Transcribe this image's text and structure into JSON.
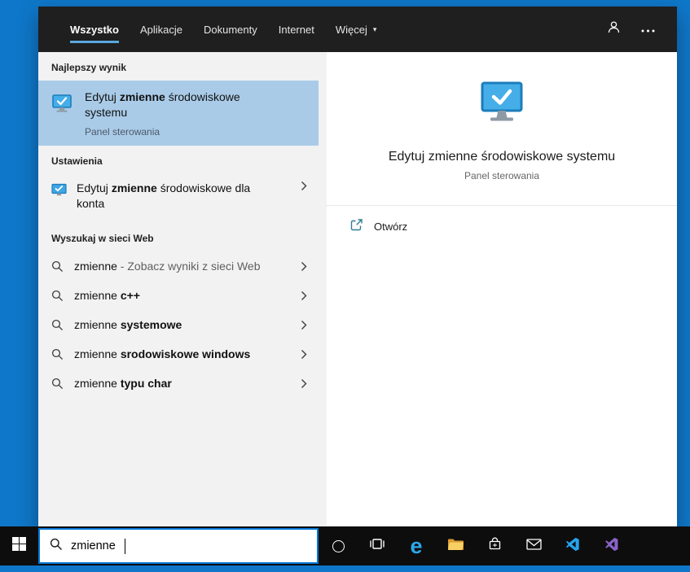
{
  "icons": {
    "dropdown": "▾",
    "edge": "e"
  },
  "colors": {
    "accent": "#0078d7",
    "desktop_background": "#0f77c9",
    "selection_highlight": "#a9cbe8",
    "topbar_background": "#1f1f1f"
  },
  "topbar": {
    "tabs": [
      {
        "label": "Wszystko",
        "active": true
      },
      {
        "label": "Aplikacje",
        "active": false
      },
      {
        "label": "Dokumenty",
        "active": false
      },
      {
        "label": "Internet",
        "active": false
      },
      {
        "label": "Więcej",
        "active": false,
        "has_dropdown": true
      }
    ]
  },
  "left_panel": {
    "sections": {
      "best": {
        "header": "Najlepszy wynik"
      },
      "settings": {
        "header": "Ustawienia"
      },
      "web": {
        "header": "Wyszukaj w sieci Web"
      }
    },
    "best_item": {
      "pre": "Edytuj ",
      "match": "zmienne",
      "post": " środowiskowe systemu",
      "subtitle": "Panel sterowania"
    },
    "settings_item": {
      "pre": "Edytuj ",
      "match": "zmienne",
      "post": " środowiskowe dla konta"
    },
    "web_items": [
      {
        "query": "zmienne",
        "bold": "",
        "suffix": " - Zobacz wyniki z sieci Web"
      },
      {
        "query": "zmienne ",
        "bold": "c++",
        "suffix": ""
      },
      {
        "query": "zmienne ",
        "bold": "systemowe",
        "suffix": ""
      },
      {
        "query": "zmienne ",
        "bold": "srodowiskowe windows",
        "suffix": ""
      },
      {
        "query": "zmienne ",
        "bold": "typu char",
        "suffix": ""
      }
    ]
  },
  "preview": {
    "title": "Edytuj zmienne środowiskowe systemu",
    "subtitle": "Panel sterowania",
    "open_label": "Otwórz"
  },
  "taskbar": {
    "search_value": "zmienne"
  }
}
